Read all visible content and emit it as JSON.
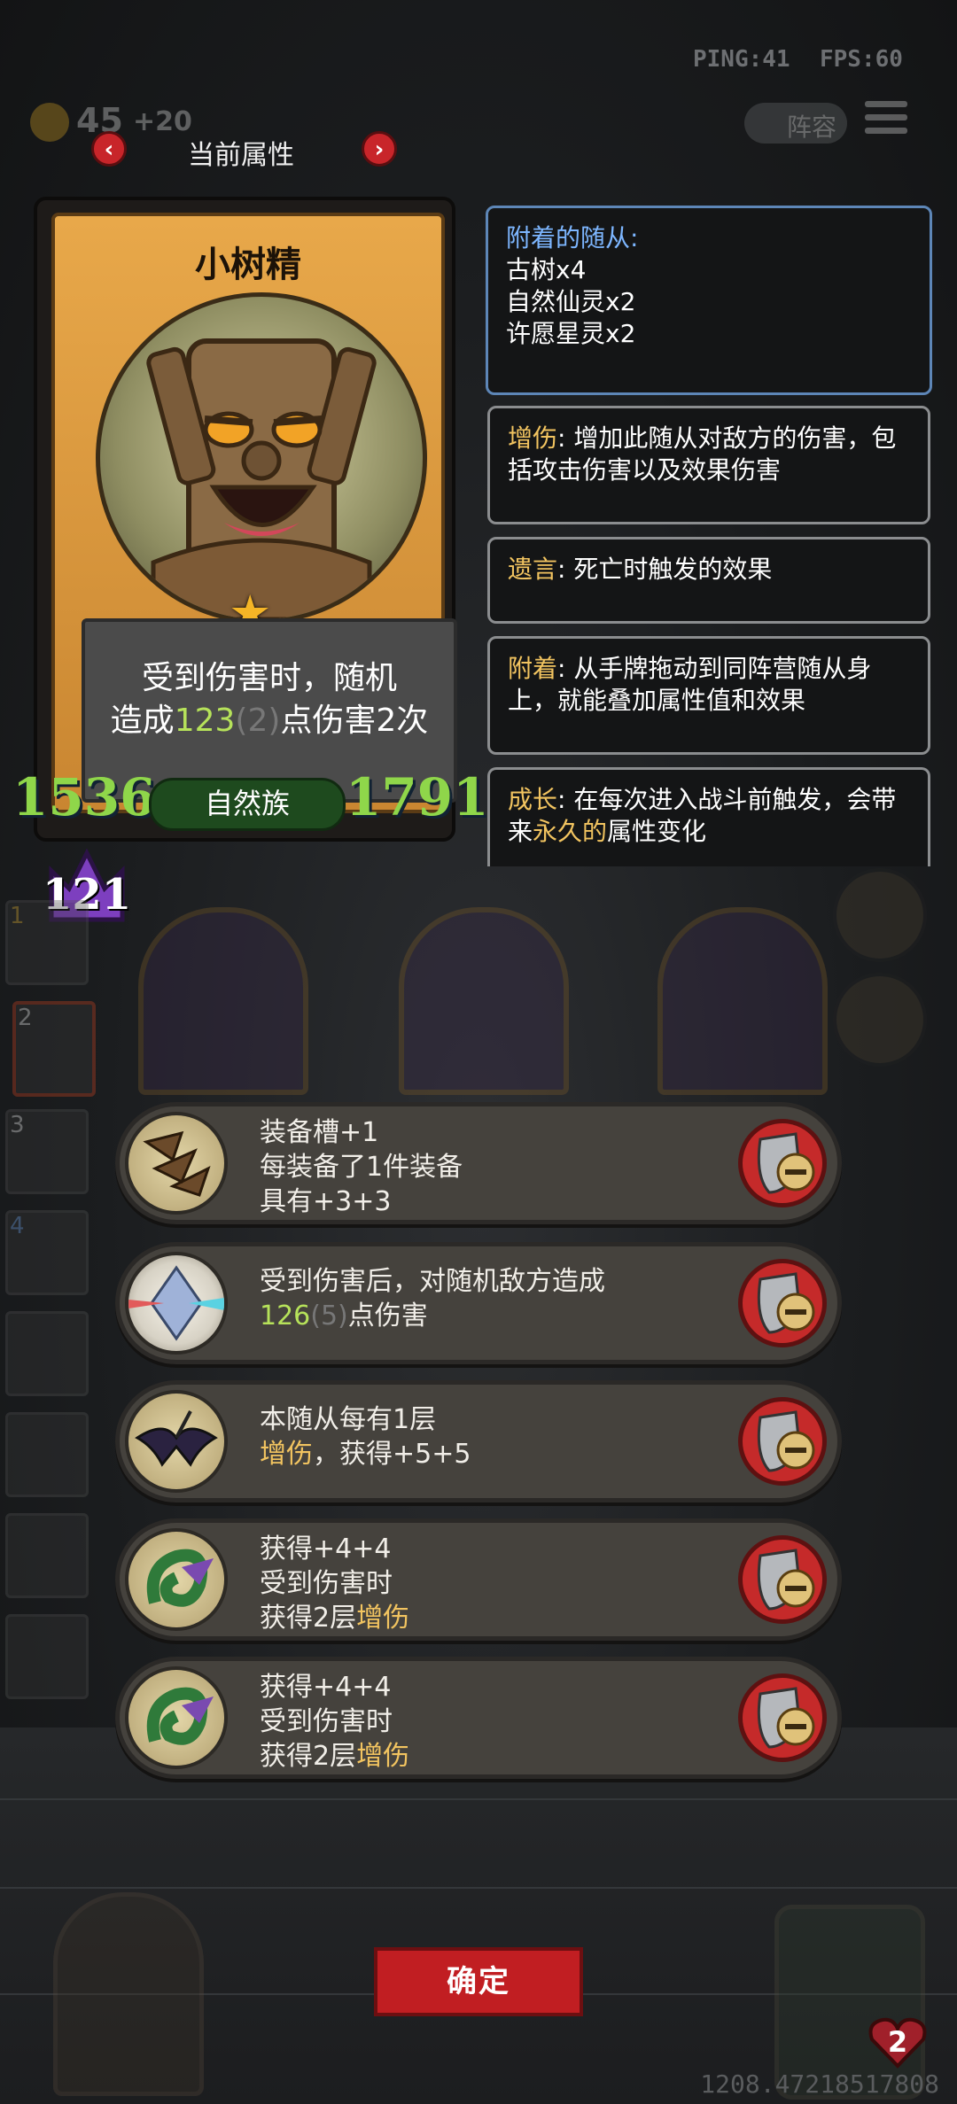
{
  "hud": {
    "ping": "PING:41",
    "fps": "FPS:60",
    "coins": "45",
    "coins_bonus": "+20",
    "lineup_label": "阵容"
  },
  "panel": {
    "title": "当前属性"
  },
  "card": {
    "name": "小树精",
    "desc_line1": "受到伤害时，随机",
    "desc_prefix": "造成",
    "desc_value": "123",
    "desc_bonus": "(2)",
    "desc_suffix": "点伤害2次",
    "attack": "1536",
    "health": "1791",
    "tribe": "自然族",
    "level": "121"
  },
  "attached": {
    "title": "附着的随从:",
    "items": [
      "古树x4",
      "自然仙灵x2",
      "许愿星灵x2"
    ]
  },
  "keywords": [
    {
      "name": "增伤",
      "text": ": 增加此随从对敌方的伤害，包括攻击伤害以及效果伤害"
    },
    {
      "name": "遗言",
      "text": ": 死亡时触发的效果"
    },
    {
      "name": "附着",
      "text": ": 从手牌拖动到同阵营随从身上，就能叠加属性值和效果"
    },
    {
      "name": "成长",
      "text": ": 在每次进入战斗前触发，会带来",
      "highlight": "永久的",
      "tail": "属性变化"
    }
  ],
  "side_slots": [
    "1",
    "2",
    "3",
    "4"
  ],
  "effects": [
    {
      "icon": "claws-icon",
      "lines": [
        "装备槽+1",
        "每装备了1件装备",
        "具有+3+3"
      ]
    },
    {
      "icon": "crystal-icon",
      "line1": "受到伤害后，对随机敌方造成",
      "value": "126",
      "bonus": "(5)",
      "suffix": "点伤害"
    },
    {
      "icon": "bat-icon",
      "line1": "本随从每有1层",
      "kw": "增伤",
      "after": "，获得+5+5"
    },
    {
      "icon": "vine-icon",
      "line1": "获得+4+4",
      "line2": "受到伤害时",
      "line3a": "获得2层",
      "kw": "增伤"
    },
    {
      "icon": "vine-icon",
      "line1": "获得+4+4",
      "line2": "受到伤害时",
      "line3a": "获得2层",
      "kw": "增伤"
    }
  ],
  "confirm_label": "确定",
  "hero_hp": "2",
  "footer_id": "1208.47218517808"
}
